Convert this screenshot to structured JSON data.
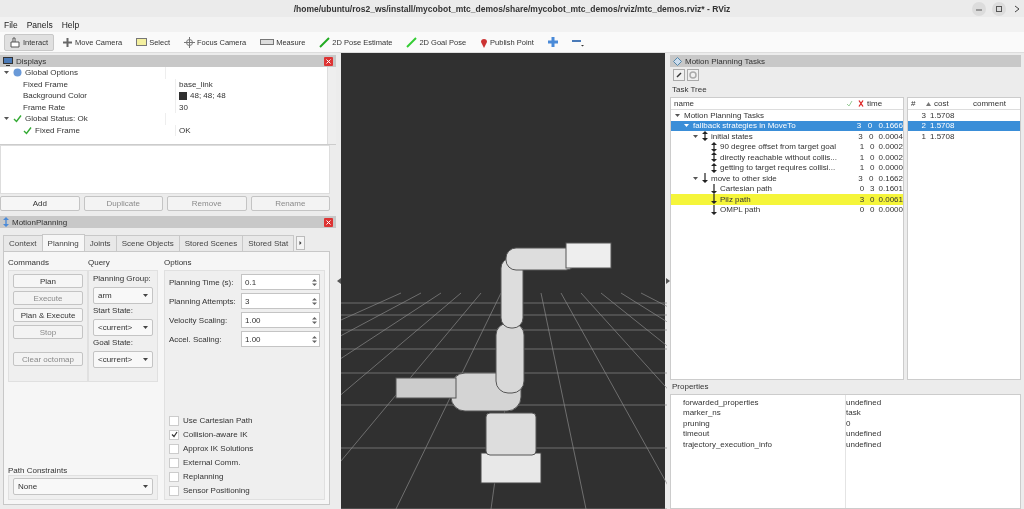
{
  "window": {
    "title": "/home/ubuntu/ros2_ws/install/mycobot_mtc_demos/share/mycobot_mtc_demos/rviz/mtc_demos.rviz* - RViz"
  },
  "menu": [
    "File",
    "Panels",
    "Help"
  ],
  "toolbar": [
    {
      "kind": "interact",
      "label": "Interact",
      "selected": true
    },
    {
      "kind": "move-camera",
      "label": "Move Camera",
      "selected": false
    },
    {
      "kind": "select",
      "label": "Select",
      "selected": false
    },
    {
      "kind": "focus-camera",
      "label": "Focus Camera",
      "selected": false
    },
    {
      "kind": "measure",
      "label": "Measure",
      "selected": false
    },
    {
      "kind": "pose-estimate",
      "label": "2D Pose Estimate",
      "selected": false
    },
    {
      "kind": "goal-pose",
      "label": "2D Goal Pose",
      "selected": false
    },
    {
      "kind": "publish-point",
      "label": "Publish Point",
      "selected": false
    },
    {
      "kind": "plus",
      "selected": false
    },
    {
      "kind": "minus",
      "selected": false
    }
  ],
  "displays": {
    "title": "Displays",
    "tree": [
      {
        "kind": "options",
        "name": "Global Options",
        "expanded": true,
        "children": [
          {
            "name": "Fixed Frame",
            "value": "base_link"
          },
          {
            "name": "Background Color",
            "value": "48; 48; 48",
            "swatch": true
          },
          {
            "name": "Frame Rate",
            "value": "30"
          }
        ]
      },
      {
        "kind": "status",
        "name": "Global Status: Ok",
        "expanded": true,
        "children": [
          {
            "kind": "status",
            "name": "Fixed Frame",
            "value": "OK"
          }
        ]
      }
    ],
    "buttons": [
      {
        "label": "Add",
        "disabled": false
      },
      {
        "label": "Duplicate",
        "disabled": true
      },
      {
        "label": "Remove",
        "disabled": true
      },
      {
        "label": "Rename",
        "disabled": true
      }
    ]
  },
  "motion_planning": {
    "title": "MotionPlanning",
    "tabs": [
      {
        "label": "Context",
        "selected": false
      },
      {
        "label": "Planning",
        "selected": true
      },
      {
        "label": "Joints",
        "selected": false
      },
      {
        "label": "Scene Objects",
        "selected": false
      },
      {
        "label": "Stored Scenes",
        "selected": false
      },
      {
        "label": "Stored Stat",
        "selected": false
      }
    ],
    "commands": {
      "title": "Commands",
      "buttons": [
        {
          "label": "Plan",
          "disabled": false
        },
        {
          "label": "Execute",
          "disabled": true
        },
        {
          "label": "Plan & Execute",
          "disabled": false
        },
        {
          "label": "Stop",
          "disabled": true
        },
        {
          "label": "Clear octomap",
          "disabled": true
        }
      ]
    },
    "query": {
      "title": "Query",
      "fields": [
        {
          "label": "Planning Group:",
          "value": "arm"
        },
        {
          "label": "Start State:",
          "value": "<current>"
        },
        {
          "label": "Goal State:",
          "value": "<current>"
        }
      ]
    },
    "options": {
      "title": "Options",
      "fields": [
        {
          "label": "Planning Time (s):",
          "value": "0.1"
        },
        {
          "label": "Planning Attempts:",
          "value": "3"
        },
        {
          "label": "Velocity Scaling:",
          "value": "1.00"
        },
        {
          "label": "Accel. Scaling:",
          "value": "1.00"
        }
      ],
      "checkboxes": [
        {
          "label": "Use Cartesian Path",
          "checked": false
        },
        {
          "label": "Collision-aware IK",
          "checked": true
        },
        {
          "label": "Approx IK Solutions",
          "checked": false
        },
        {
          "label": "External Comm.",
          "checked": false
        },
        {
          "label": "Replanning",
          "checked": false
        },
        {
          "label": "Sensor Positioning",
          "checked": false
        }
      ]
    },
    "path_constraints": {
      "label": "Path Constraints",
      "value": "None"
    }
  },
  "tasks": {
    "title": "Motion Planning Tasks",
    "tree_label": "Task Tree",
    "columns": [
      "name",
      "time"
    ],
    "tree": [
      {
        "name": "Motion Planning Tasks",
        "expanded": true,
        "selected": false,
        "highlighted": false,
        "children": [
          {
            "name": "fallback strategies in MoveTo",
            "success": "3",
            "failed": "0",
            "time": "0.1666",
            "expanded": true,
            "selected": true,
            "highlighted": false,
            "children": [
              {
                "kind": "parallel",
                "name": "initial states",
                "success": "3",
                "failed": "0",
                "time": "0.0004",
                "expanded": true,
                "selected": false,
                "highlighted": false,
                "children": [
                  {
                    "kind": "parallel",
                    "name": "90 degree offset from target goal",
                    "success": "1",
                    "failed": "0",
                    "time": "0.0002",
                    "selected": false,
                    "highlighted": false
                  },
                  {
                    "kind": "parallel",
                    "name": "directly reachable without collis...",
                    "success": "1",
                    "failed": "0",
                    "time": "0.0002",
                    "selected": false,
                    "highlighted": false
                  },
                  {
                    "kind": "parallel",
                    "name": "getting to target requires collisi...",
                    "success": "1",
                    "failed": "0",
                    "time": "0.0000",
                    "selected": false,
                    "highlighted": false
                  }
                ]
              },
              {
                "kind": "forward",
                "name": "move to other side",
                "success": "3",
                "failed": "0",
                "time": "0.1662",
                "expanded": true,
                "selected": false,
                "highlighted": false,
                "children": [
                  {
                    "kind": "forward",
                    "name": "Cartesian path",
                    "success": "0",
                    "failed": "3",
                    "time": "0.1601",
                    "selected": false,
                    "highlighted": false
                  },
                  {
                    "kind": "forward",
                    "name": "Pilz path",
                    "success": "3",
                    "failed": "0",
                    "time": "0.0061",
                    "selected": false,
                    "highlighted": true
                  },
                  {
                    "kind": "forward",
                    "name": "OMPL path",
                    "success": "0",
                    "failed": "0",
                    "time": "0.0000",
                    "selected": false,
                    "highlighted": false
                  }
                ]
              }
            ]
          }
        ]
      }
    ],
    "solutions": {
      "columns": [
        "#",
        "cost",
        "comment"
      ],
      "rows": [
        {
          "id": "3",
          "cost": "1.5708",
          "selected": false
        },
        {
          "id": "2",
          "cost": "1.5708",
          "selected": true
        },
        {
          "id": "1",
          "cost": "1.5708",
          "selected": false
        }
      ]
    },
    "properties": {
      "title": "Properties",
      "rows": [
        {
          "name": "forwarded_properties",
          "value": "undefined"
        },
        {
          "name": "marker_ns",
          "value": "task"
        },
        {
          "name": "pruning",
          "value": "0"
        },
        {
          "name": "timeout",
          "value": "undefined"
        },
        {
          "name": "trajectory_execution_info",
          "value": "undefined"
        }
      ]
    }
  }
}
